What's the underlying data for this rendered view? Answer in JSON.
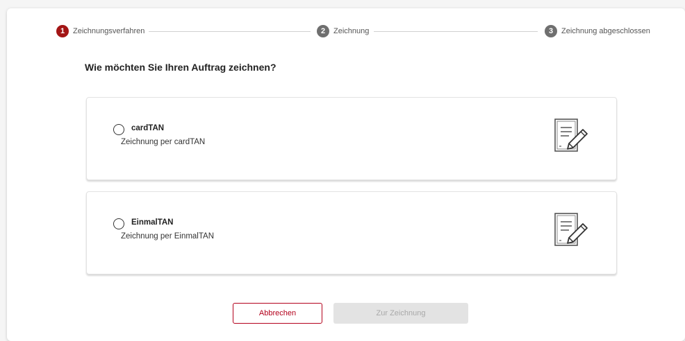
{
  "stepper": {
    "steps": [
      {
        "number": "1",
        "label": "Zeichnungsverfahren",
        "state": "active"
      },
      {
        "number": "2",
        "label": "Zeichnung",
        "state": "pending"
      },
      {
        "number": "3",
        "label": "Zeichnung abgeschlossen",
        "state": "pending"
      }
    ]
  },
  "main": {
    "question": "Wie möchten Sie Ihren Auftrag zeichnen?",
    "options": [
      {
        "title": "cardTAN",
        "subtitle": "Zeichnung per cardTAN",
        "selected": false,
        "icon": "sign-document-icon"
      },
      {
        "title": "EinmalTAN",
        "subtitle": "Zeichnung per EinmalTAN",
        "selected": false,
        "icon": "sign-document-icon"
      }
    ]
  },
  "actions": {
    "cancel_label": "Abbrechen",
    "submit_label": "Zur Zeichnung"
  },
  "colors": {
    "accent": "#a31515",
    "inactive_step": "#6f6f6f",
    "disabled_button": "#e3e3e3"
  }
}
